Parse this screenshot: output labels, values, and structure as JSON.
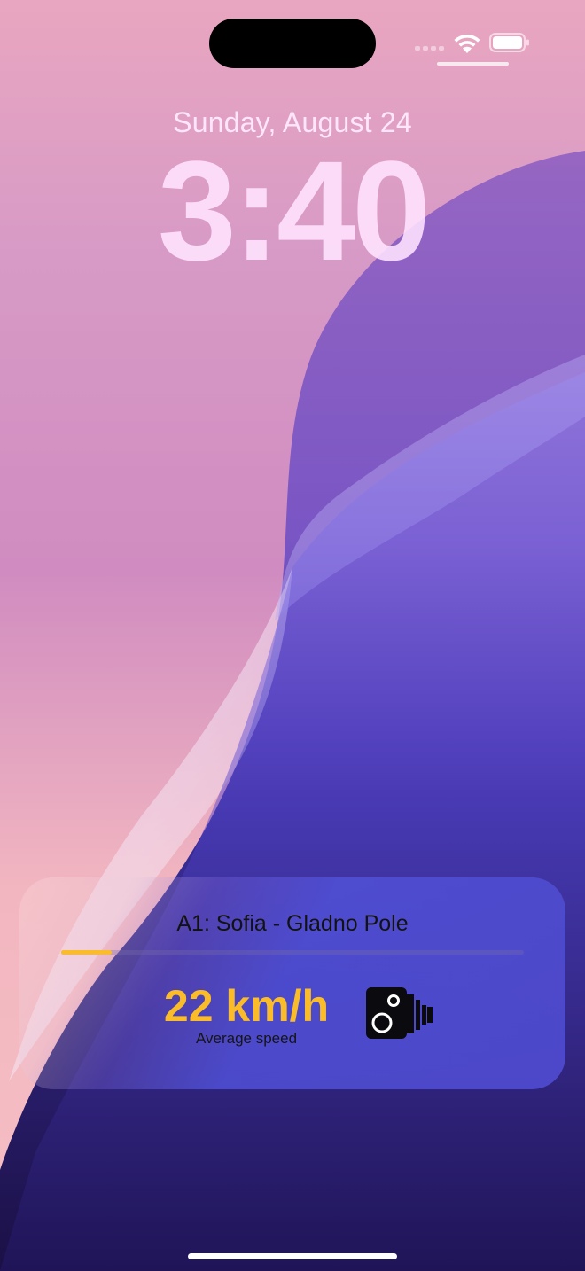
{
  "status_bar": {
    "wifi_icon": "wifi-icon",
    "battery_icon": "battery-icon",
    "signal_icon": "cellular-signal-icon"
  },
  "lock_screen": {
    "date": "Sunday, August 24",
    "time": "3:40"
  },
  "live_activity": {
    "route": "A1: Sofia - Gladno Pole",
    "progress": 0.11,
    "speed": "22 km/h",
    "speed_label": "Average speed",
    "icon": "speed-camera-icon",
    "accent_color": "#fbbc29"
  }
}
